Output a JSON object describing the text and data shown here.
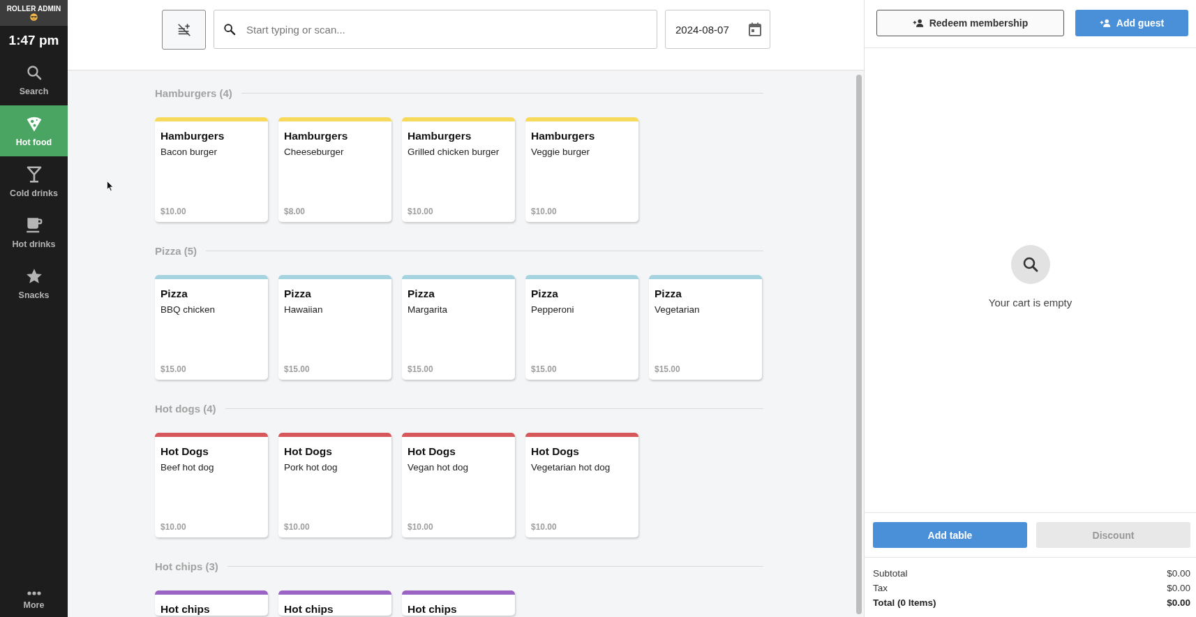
{
  "sidebar": {
    "account": "ROLLER ADMIN",
    "time": "1:47 pm",
    "items": [
      {
        "label": "Search",
        "selected": false
      },
      {
        "label": "Hot food",
        "selected": true
      },
      {
        "label": "Cold drinks",
        "selected": false
      },
      {
        "label": "Hot drinks",
        "selected": false
      },
      {
        "label": "Snacks",
        "selected": false
      }
    ],
    "more": "More"
  },
  "toolbar": {
    "search": {
      "placeholder": "Start typing or scan..."
    },
    "date": "2024-08-07"
  },
  "sections": [
    {
      "title": "Hamburgers (4)",
      "color": "#f7d95c",
      "products": [
        {
          "category": "Hamburgers",
          "name": "Bacon burger",
          "price": "$10.00"
        },
        {
          "category": "Hamburgers",
          "name": "Cheeseburger",
          "price": "$8.00"
        },
        {
          "category": "Hamburgers",
          "name": "Grilled chicken burger",
          "price": "$10.00"
        },
        {
          "category": "Hamburgers",
          "name": "Veggie burger",
          "price": "$10.00"
        }
      ]
    },
    {
      "title": "Pizza (5)",
      "color": "#a6d3e0",
      "products": [
        {
          "category": "Pizza",
          "name": "BBQ chicken",
          "price": "$15.00"
        },
        {
          "category": "Pizza",
          "name": "Hawaiian",
          "price": "$15.00"
        },
        {
          "category": "Pizza",
          "name": "Margarita",
          "price": "$15.00"
        },
        {
          "category": "Pizza",
          "name": "Pepperoni",
          "price": "$15.00"
        },
        {
          "category": "Pizza",
          "name": "Vegetarian",
          "price": "$15.00"
        }
      ]
    },
    {
      "title": "Hot dogs (4)",
      "color": "#d6585a",
      "products": [
        {
          "category": "Hot Dogs",
          "name": "Beef hot dog",
          "price": "$10.00"
        },
        {
          "category": "Hot Dogs",
          "name": "Pork hot dog",
          "price": "$10.00"
        },
        {
          "category": "Hot Dogs",
          "name": "Vegan hot dog",
          "price": "$10.00"
        },
        {
          "category": "Hot Dogs",
          "name": "Vegetarian hot dog",
          "price": "$10.00"
        }
      ]
    },
    {
      "title": "Hot chips (3)",
      "color": "#9b63c4",
      "products": [
        {
          "category": "Hot chips"
        },
        {
          "category": "Hot chips"
        },
        {
          "category": "Hot chips"
        }
      ]
    }
  ],
  "cart": {
    "buttons": [
      {
        "label": "Redeem membership",
        "kind": "outline"
      },
      {
        "label": "Add guest",
        "kind": "primary"
      }
    ],
    "empty_message": "Your cart is empty",
    "actions": [
      {
        "label": "Add table",
        "disabled": false
      },
      {
        "label": "Discount",
        "disabled": true
      }
    ],
    "totals": [
      {
        "label": "Subtotal",
        "value": "$0.00",
        "kind": "line"
      },
      {
        "label": "Tax",
        "value": "$0.00",
        "kind": "line"
      },
      {
        "label": "Total (0 Items)",
        "value": "$0.00",
        "kind": "total"
      }
    ]
  }
}
